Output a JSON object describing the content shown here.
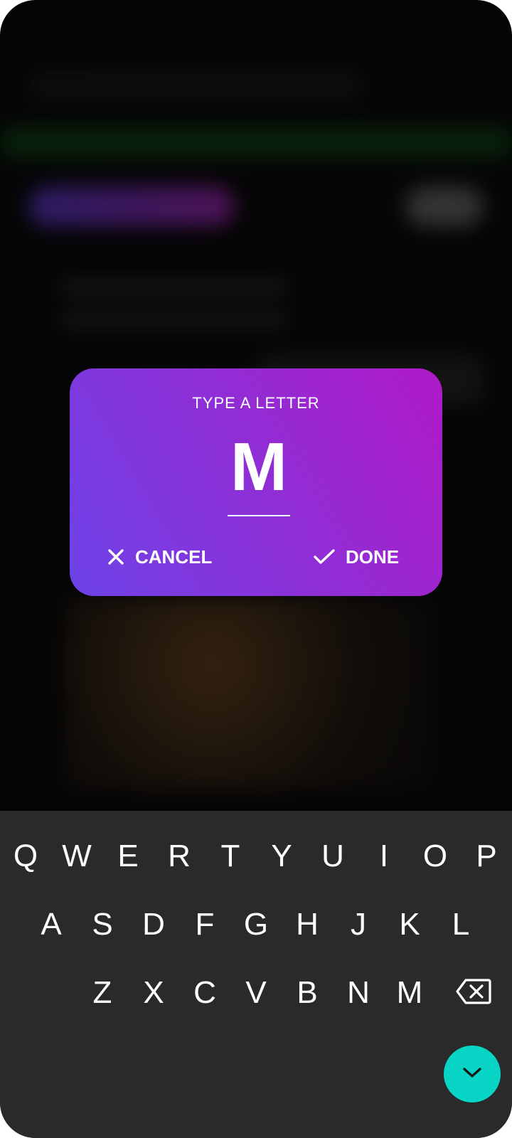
{
  "dialog": {
    "title": "TYPE A LETTER",
    "letter_value": "M",
    "cancel_label": "CANCEL",
    "done_label": "DONE"
  },
  "keyboard": {
    "row1": [
      "Q",
      "W",
      "E",
      "R",
      "T",
      "Y",
      "U",
      "I",
      "O",
      "P"
    ],
    "row2": [
      "A",
      "S",
      "D",
      "F",
      "G",
      "H",
      "J",
      "K",
      "L"
    ],
    "row3": [
      "Z",
      "X",
      "C",
      "V",
      "B",
      "N",
      "M"
    ],
    "backspace_icon": "backspace-icon",
    "hide_icon": "chevron-down-icon"
  },
  "colors": {
    "dialog_gradient_start": "#6d43e8",
    "dialog_gradient_end": "#b01ac8",
    "keyboard_bg": "#2a2a2a",
    "hide_button": "#08d5c6"
  }
}
